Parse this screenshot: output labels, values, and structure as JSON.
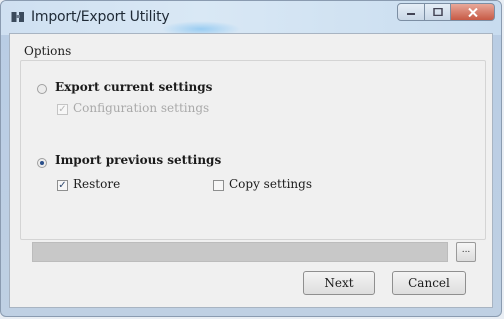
{
  "window": {
    "title": "Import/Export Utility"
  },
  "options": {
    "group_label": "Options",
    "export": {
      "label": "Export current settings",
      "selected": false,
      "sub_option": {
        "label": "Configuration settings",
        "checked": true,
        "enabled": false
      }
    },
    "import": {
      "label": "Import previous settings",
      "selected": true,
      "restore": {
        "label": "Restore",
        "checked": true
      },
      "copy": {
        "label": "Copy settings",
        "checked": false
      }
    }
  },
  "path_field": {
    "value": ""
  },
  "browse_button": {
    "label": "..."
  },
  "buttons": {
    "next": "Next",
    "cancel": "Cancel"
  },
  "check_glyph": "✓"
}
